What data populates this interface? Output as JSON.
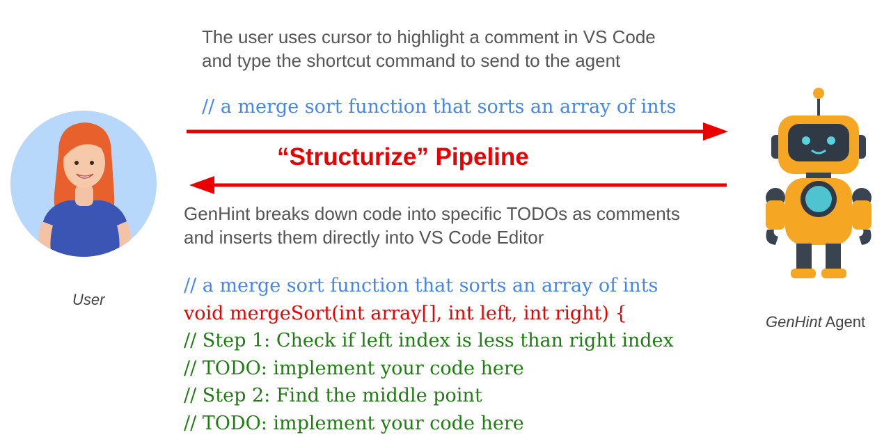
{
  "top_note": {
    "line1": "The user uses cursor to highlight a comment in VS Code",
    "line2": "and type the shortcut command to send to the agent"
  },
  "request_comment": "// a merge sort function that sorts an array of ints",
  "pipeline_title": "“Structurize” Pipeline",
  "bottom_note": {
    "line1": "GenHint breaks down code into specific TODOs as comments",
    "line2": "and inserts them directly into VS Code Editor"
  },
  "code_lines": [
    "// a merge sort function that sorts an array of ints",
    "void mergeSort(int array[], int left, int right) {",
    "// Step 1: Check if left index is less than right index",
    "// TODO: implement your code here",
    "// Step 2: Find the middle point",
    "// TODO: implement your code here"
  ],
  "user_caption": "User",
  "agent_caption": {
    "name": "GenHint",
    "suffix": " Agent"
  },
  "colors": {
    "arrow": "#ea0000",
    "comment_blue": "#4285f4",
    "code_red": "#ea0000",
    "comment_green": "#1e7d11",
    "robot_orange": "#f5a623",
    "avatar_bg": "#b8d8fb"
  },
  "icons": {
    "user": "woman-avatar-icon",
    "agent": "robot-icon"
  }
}
